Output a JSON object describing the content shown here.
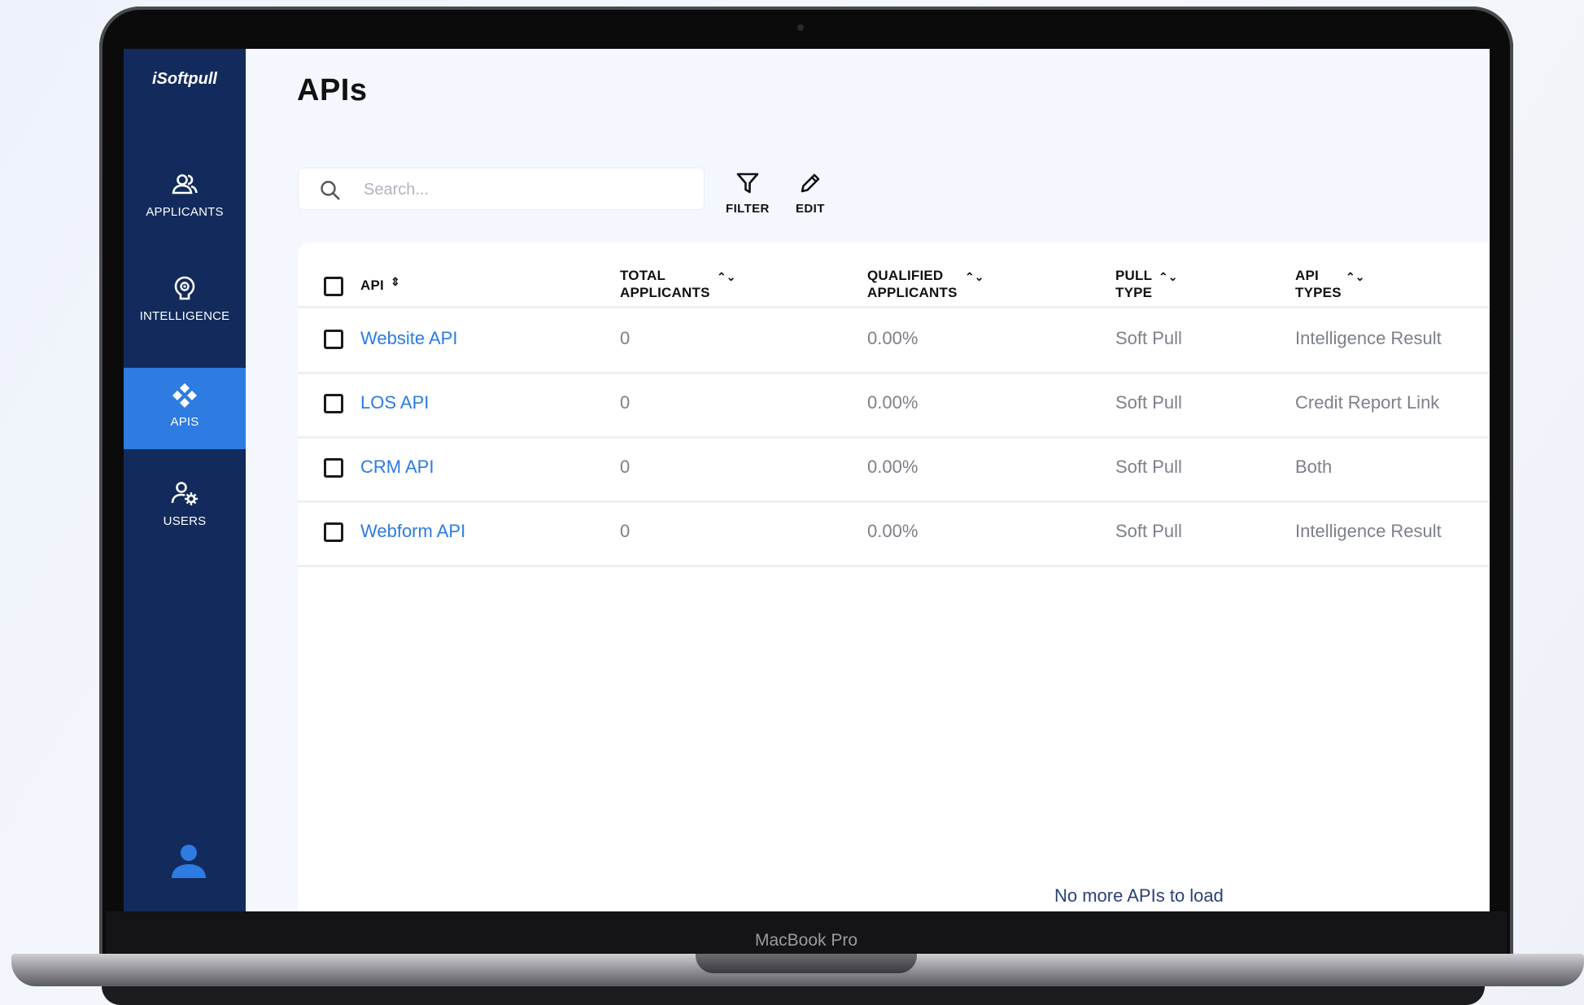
{
  "device": {
    "label": "MacBook Pro"
  },
  "sidebar": {
    "logo": "iSoftpull",
    "items": [
      {
        "label": "APPLICANTS",
        "icon": "people-icon",
        "active": false
      },
      {
        "label": "INTELLIGENCE",
        "icon": "brain-icon",
        "active": false
      },
      {
        "label": "APIS",
        "icon": "api-diamond-icon",
        "active": true
      },
      {
        "label": "USERS",
        "icon": "user-settings-icon",
        "active": false
      }
    ],
    "profile_icon": "person-icon"
  },
  "page": {
    "title": "APIs"
  },
  "search": {
    "placeholder": "Search..."
  },
  "toolbar": {
    "filter_label": "FILTER",
    "edit_label": "EDIT"
  },
  "table": {
    "columns": [
      {
        "line1": "API",
        "line2": ""
      },
      {
        "line1": "TOTAL",
        "line2": "APPLICANTS"
      },
      {
        "line1": "QUALIFIED",
        "line2": "APPLICANTS"
      },
      {
        "line1": "PULL",
        "line2": "TYPE"
      },
      {
        "line1": "API",
        "line2": "TYPES"
      }
    ],
    "rows": [
      {
        "api": "Website API",
        "total": "0",
        "qualified": "0.00%",
        "pull_type": "Soft Pull",
        "api_types": "Intelligence Result"
      },
      {
        "api": "LOS API",
        "total": "0",
        "qualified": "0.00%",
        "pull_type": "Soft Pull",
        "api_types": "Credit Report Link"
      },
      {
        "api": "CRM API",
        "total": "0",
        "qualified": "0.00%",
        "pull_type": "Soft Pull",
        "api_types": "Both"
      },
      {
        "api": "Webform API",
        "total": "0",
        "qualified": "0.00%",
        "pull_type": "Soft Pull",
        "api_types": "Intelligence Result"
      }
    ],
    "empty_message": "No more APIs to load"
  },
  "colors": {
    "sidebar_bg": "#122b5c",
    "active_item": "#2e7be2",
    "link": "#2a7be4"
  }
}
